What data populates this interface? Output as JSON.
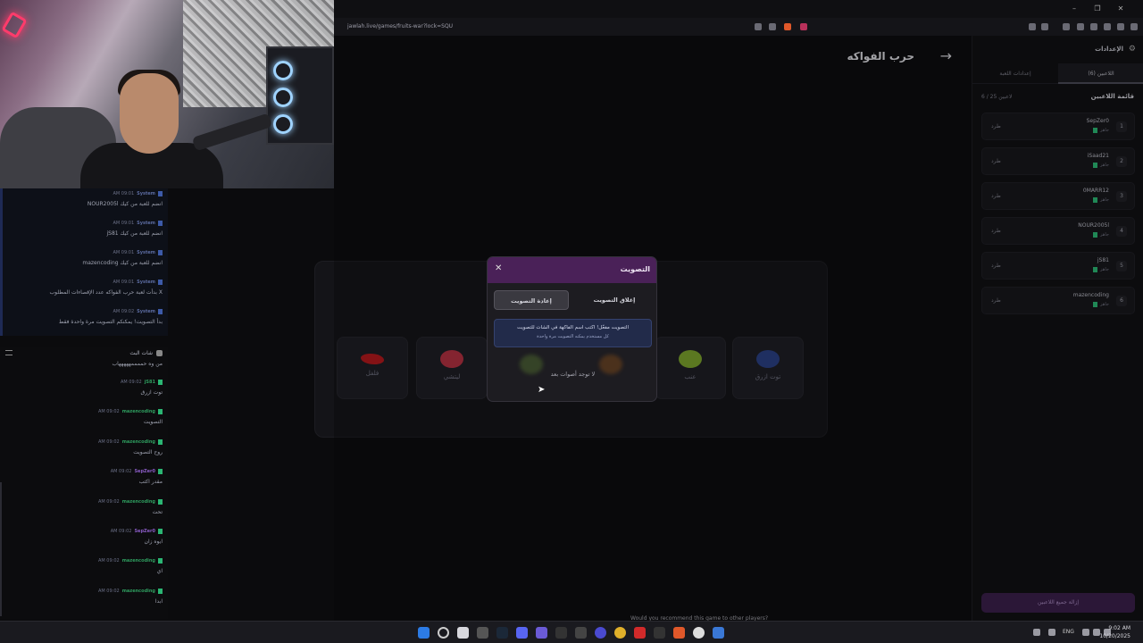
{
  "browser": {
    "url": "jawlah.live/games/fruits-war?lock=SQU"
  },
  "page": {
    "title": "حرب الفواكه",
    "fruits": [
      {
        "label": "فلفل",
        "color": "#b0181c"
      },
      {
        "label": "ليتشي",
        "color": "#b13040"
      },
      {
        "label": "عنب",
        "color": "#7aa12c"
      },
      {
        "label": "توت ازرق",
        "color": "#2a3f82"
      }
    ]
  },
  "panel": {
    "title": "الإعدادات",
    "tabs": [
      "اللاعبين (6)",
      "إعدادات اللعبة"
    ],
    "players_heading": "قائمة اللاعبين",
    "players_count": "6 / 25 لاعبين",
    "kick_label": "طرد",
    "player_sub": "جاهز",
    "players": [
      {
        "num": "1",
        "name": "SepZer0"
      },
      {
        "num": "2",
        "name": "iSaad21"
      },
      {
        "num": "3",
        "name": "0MARR12"
      },
      {
        "num": "4",
        "name": "NOUR2005l"
      },
      {
        "num": "5",
        "name": "jS81"
      },
      {
        "num": "6",
        "name": "mazencoding"
      }
    ],
    "remove_all": "إزالة جميع اللاعبين"
  },
  "modal": {
    "title": "التصويت",
    "tab_close": "إغلاق التصويت",
    "tab_restart": "إعادة التصويت",
    "notice_line1": "التصويت مفعّل! اكتب اسم الفاكهة في الشات للتصويت",
    "notice_line2": "كل مستخدم يمكنه التصويت مرة واحدة",
    "no_votes": "لا توجد أصوات بعد"
  },
  "chat": {
    "header": "شات البث",
    "system_messages": [
      {
        "user": "System",
        "time": "AM 09:01",
        "text": "NOUR2005l انضم للعبة من كيك"
      },
      {
        "user": "System",
        "time": "AM 09:01",
        "text": "jS81 انضم للعبة من كيك"
      },
      {
        "user": "System",
        "time": "AM 09:01",
        "text": "mazencoding انضم للعبة من كيك"
      },
      {
        "user": "System",
        "time": "AM 09:01",
        "text": "بدأت لعبة حرب الفواكه عدد الإقصاءات المطلوب X"
      },
      {
        "user": "System",
        "time": "AM 09:02",
        "text": "بدأ التصويت! يمكنكم التصويت مرة واحدة فقط"
      }
    ],
    "top_partial_text": "من وه حممممهههههاب",
    "messages": [
      {
        "user": "jS81",
        "time": "AM 09:02",
        "text": "توت ازرق",
        "color": "green"
      },
      {
        "user": "mazencoding",
        "time": "AM 09:02",
        "text": "التصويت",
        "color": "green"
      },
      {
        "user": "mazencoding",
        "time": "AM 09:02",
        "text": "روح التصويت",
        "color": "green"
      },
      {
        "user": "SepZer0",
        "time": "AM 09:02",
        "text": "مقدر اكتب",
        "color": "purple"
      },
      {
        "user": "mazencoding",
        "time": "AM 09:02",
        "text": "تحت",
        "color": "green"
      },
      {
        "user": "SepZer0",
        "time": "AM 09:02",
        "text": "ايوه زان",
        "color": "purple"
      },
      {
        "user": "mazencoding",
        "time": "AM 09:02",
        "text": "اي",
        "color": "green"
      },
      {
        "user": "mazencoding",
        "time": "AM 09:02",
        "text": "ابدا",
        "color": "green"
      }
    ]
  },
  "taskbar": {
    "caption": "Would you recommend this game to other players?",
    "lang": "ENG",
    "time": "9:02 AM",
    "date": "10/20/2025"
  }
}
